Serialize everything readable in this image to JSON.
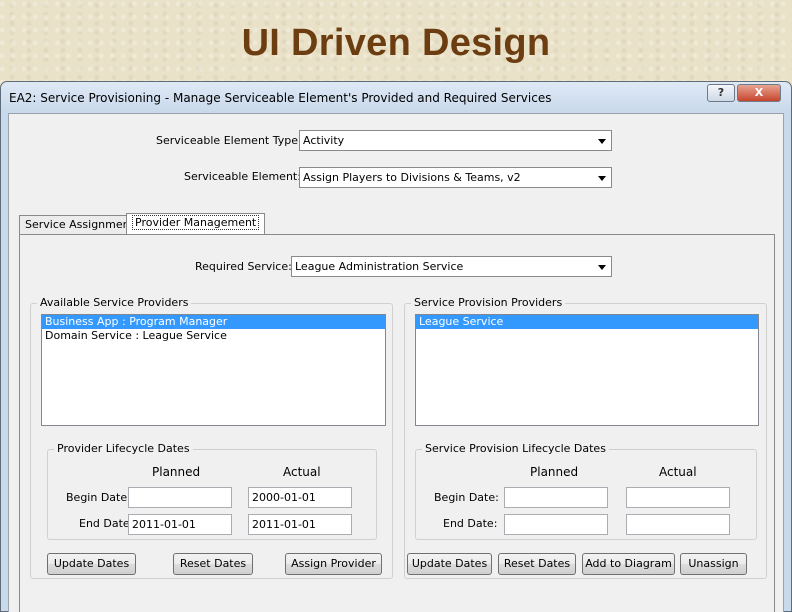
{
  "slide": {
    "title": "UI Driven Design"
  },
  "window": {
    "title": "EA2: Service Provisioning - Manage Serviceable Element's Provided and Required Services",
    "help_label": "?",
    "close_label": "X"
  },
  "selectors": {
    "element_type_label": "Serviceable Element Type:",
    "element_type_value": "Activity",
    "element_label": "Serviceable Element:",
    "element_value": "Assign Players to Divisions & Teams, v2"
  },
  "tabs": [
    {
      "label": "Service Assignment",
      "active": false
    },
    {
      "label": "Provider Management",
      "active": true
    }
  ],
  "provider_management": {
    "required_service_label": "Required Service:",
    "required_service_value": "League Administration Service",
    "available": {
      "title": "Available Service Providers",
      "items": [
        "Business App : Program Manager",
        "Domain Service : League Service"
      ],
      "selected_index": 0,
      "dates": {
        "title": "Provider Lifecycle Dates",
        "planned_header": "Planned",
        "actual_header": "Actual",
        "begin_label": "Begin Date:",
        "end_label": "End Date:",
        "begin_planned": "",
        "begin_actual": "2000-01-01",
        "end_planned": "2011-01-01",
        "end_actual": "2011-01-01"
      },
      "buttons": {
        "update": "Update Dates",
        "reset": "Reset Dates",
        "assign": "Assign Provider"
      }
    },
    "provision": {
      "title": "Service Provision Providers",
      "items": [
        "League Service"
      ],
      "selected_index": 0,
      "dates": {
        "title": "Service Provision Lifecycle Dates",
        "planned_header": "Planned",
        "actual_header": "Actual",
        "begin_label": "Begin Date:",
        "end_label": "End Date:",
        "begin_planned": "",
        "begin_actual": "",
        "end_planned": "",
        "end_actual": ""
      },
      "buttons": {
        "update": "Update Dates",
        "reset": "Reset Dates",
        "diagram": "Add to Diagram",
        "unassign": "Unassign"
      }
    }
  },
  "colors": {
    "title_brown": "#6b3d10",
    "selection_blue": "#3399ff"
  }
}
